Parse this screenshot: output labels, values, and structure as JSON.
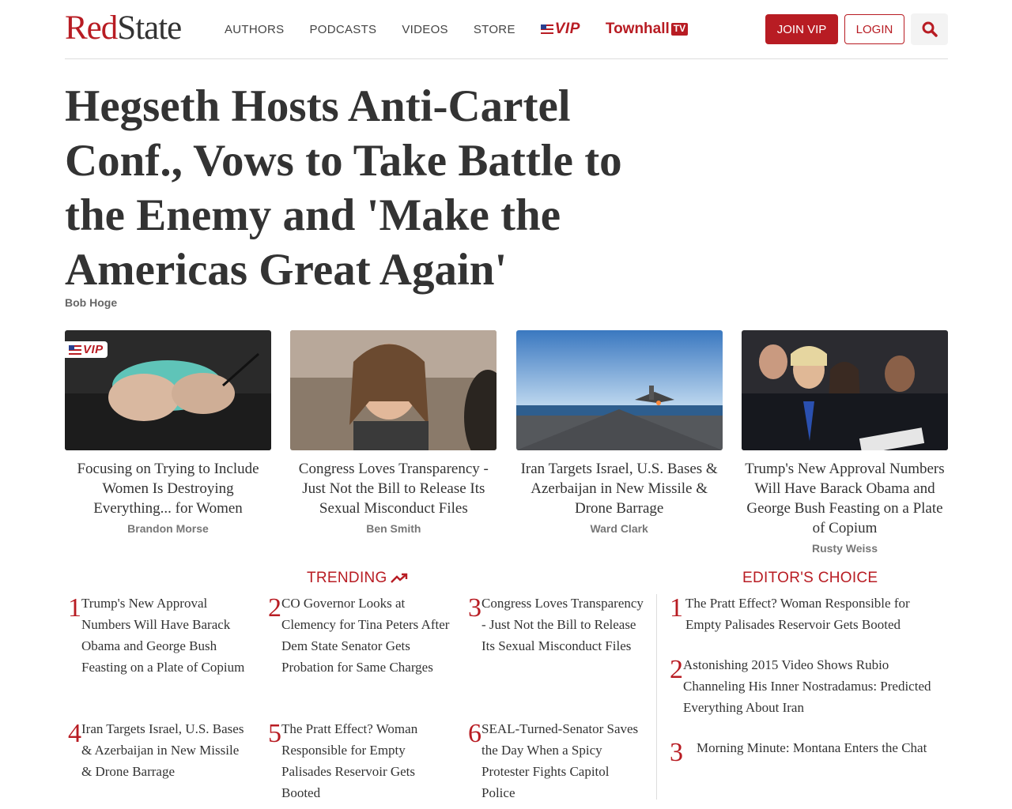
{
  "header": {
    "logo_red": "Red",
    "logo_dark": "State",
    "nav": [
      "AUTHORS",
      "PODCASTS",
      "VIDEOS",
      "STORE"
    ],
    "vip_label": "VIP",
    "townhall_label": "Townhall",
    "townhall_tv": "TV",
    "join_label": "JOIN VIP",
    "login_label": "LOGIN",
    "search_icon": "search-icon"
  },
  "colors": {
    "brand_red": "#b81c23",
    "text": "#333333"
  },
  "article": {
    "headline": "Hegseth Hosts Anti-Cartel Conf., Vows to Take Battle to the Enemy and 'Make the Americas Great Again'",
    "author": "Bob Hoge"
  },
  "cards": [
    {
      "title": "Focusing on Trying to Include Women Is Destroying Everything... for Women",
      "author": "Brandon Morse",
      "vip": "VIP"
    },
    {
      "title": "Congress Loves Transparency - Just Not the Bill to Release Its Sexual Misconduct Files",
      "author": "Ben Smith"
    },
    {
      "title": "Iran Targets Israel, U.S. Bases & Azerbaijan in New Missile & Drone Barrage",
      "author": "Ward Clark"
    },
    {
      "title": "Trump's New Approval Numbers Will Have Barack Obama and George Bush Feasting on a Plate of Copium",
      "author": "Rusty Weiss"
    }
  ],
  "trending": {
    "title": "TRENDING",
    "items": [
      {
        "num": "1",
        "text": "Trump's New Approval Numbers Will Have Barack Obama and George Bush Feasting on a Plate of Copium"
      },
      {
        "num": "2",
        "text": "CO Governor Looks at Clemency for Tina Peters After Dem State Senator Gets Probation for Same Charges"
      },
      {
        "num": "3",
        "text": "Congress Loves Transparency - Just Not the Bill to Release Its Sexual Misconduct Files"
      },
      {
        "num": "4",
        "text": "Iran Targets Israel, U.S. Bases & Azerbaijan in New Missile & Drone Barrage"
      },
      {
        "num": "5",
        "text": "The Pratt Effect? Woman Responsible for Empty Palisades Reservoir Gets Booted"
      },
      {
        "num": "6",
        "text": "SEAL-Turned-Senator Saves the Day When a Spicy Protester Fights Capitol Police"
      }
    ]
  },
  "editors_choice": {
    "title": "EDITOR'S CHOICE",
    "items": [
      {
        "num": "1",
        "text": "The Pratt Effect? Woman Responsible for Empty Palisades Reservoir Gets Booted"
      },
      {
        "num": "2",
        "text": "Astonishing 2015 Video Shows Rubio Channeling His Inner Nostradamus: Predicted Everything About Iran"
      },
      {
        "num": "3",
        "text": "Morning Minute: Montana Enters the Chat"
      }
    ]
  }
}
